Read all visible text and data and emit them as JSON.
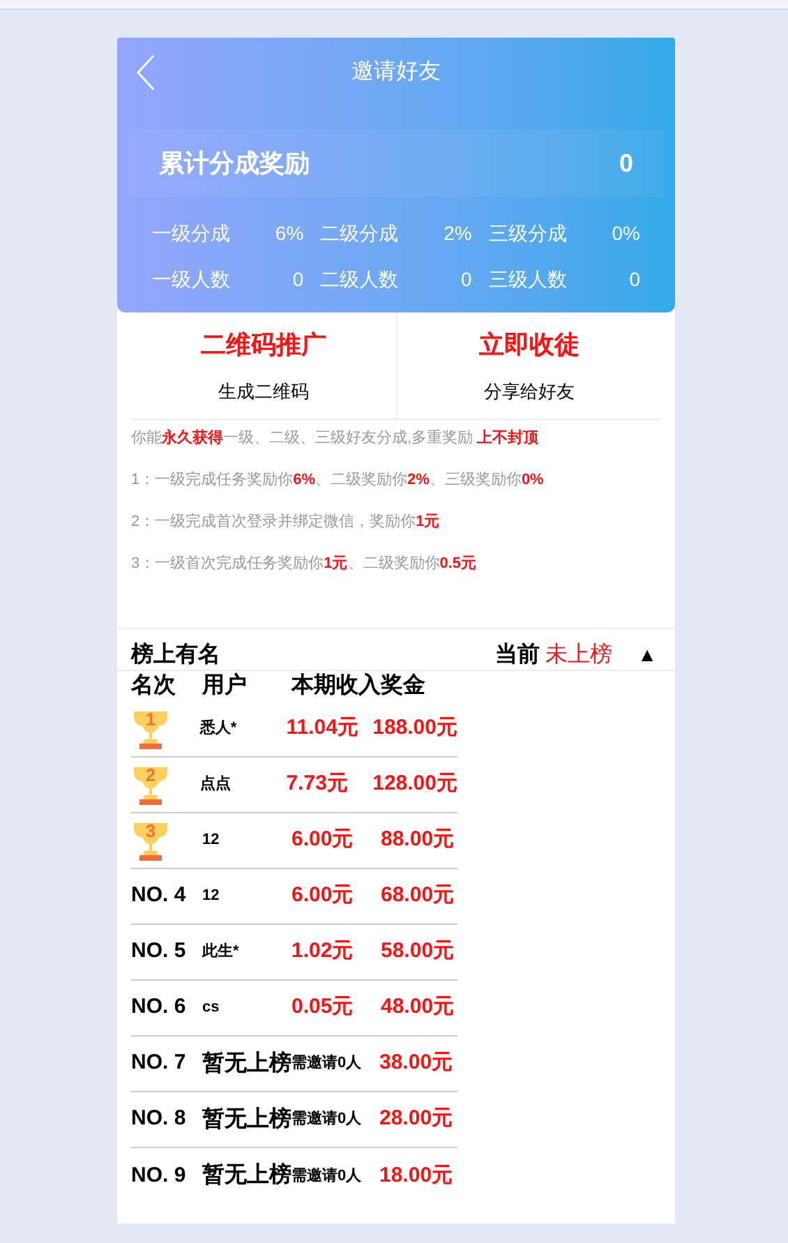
{
  "header": {
    "title": "邀请好友",
    "total_label": "累计分成奖励",
    "total_value": "0",
    "stats": [
      {
        "label": "一级分成",
        "value": "6%"
      },
      {
        "label": "二级分成",
        "value": "2%"
      },
      {
        "label": "三级分成",
        "value": "0%"
      },
      {
        "label": "一级人数",
        "value": "0"
      },
      {
        "label": "二级人数",
        "value": "0"
      },
      {
        "label": "三级人数",
        "value": "0"
      }
    ]
  },
  "actions": [
    {
      "title": "二维码推广",
      "subtitle": "生成二维码"
    },
    {
      "title": "立即收徒",
      "subtitle": "分享给好友"
    }
  ],
  "info": [
    "你能**永久获得**一级、二级、三级好友分成,多重奖励 **上不封顶**",
    "1：一级完成任务奖励你**6%**、二级奖励你**2%**、三级奖励你**0%**",
    "2：一级完成首次登录并绑定微信，奖励你**1元**",
    "3：一级首次完成任务奖励你**1元**、二级奖励你**0.5元**"
  ],
  "ranking": {
    "title": "榜上有名",
    "current_label": "当前",
    "current_value": "未上榜",
    "toggle": "▲",
    "columns": [
      "名次",
      "用户",
      "本期收入",
      "奖金"
    ],
    "rows": [
      {
        "kind": "trophy",
        "rank": "1",
        "user": "悉人*",
        "income": "11.04元",
        "bonus": "188.00元"
      },
      {
        "kind": "trophy",
        "rank": "2",
        "user": "点点",
        "income": "7.73元",
        "bonus": "128.00元"
      },
      {
        "kind": "trophy",
        "rank": "3",
        "user": "12",
        "income": "6.00元",
        "bonus": "88.00元"
      },
      {
        "kind": "number",
        "rank": "NO. 4",
        "user": "12",
        "income": "6.00元",
        "bonus": "68.00元"
      },
      {
        "kind": "number",
        "rank": "NO. 5",
        "user": "此生*",
        "income": "1.02元",
        "bonus": "58.00元"
      },
      {
        "kind": "number",
        "rank": "NO. 6",
        "user": "cs",
        "income": "0.05元",
        "bonus": "48.00元"
      },
      {
        "kind": "empty",
        "rank": "NO. 7",
        "user": "暂无上榜",
        "income": "需邀请0人",
        "bonus": "38.00元"
      },
      {
        "kind": "empty",
        "rank": "NO. 8",
        "user": "暂无上榜",
        "income": "需邀请0人",
        "bonus": "28.00元"
      },
      {
        "kind": "empty",
        "rank": "NO. 9",
        "user": "暂无上榜",
        "income": "需邀请0人",
        "bonus": "18.00元"
      }
    ]
  }
}
